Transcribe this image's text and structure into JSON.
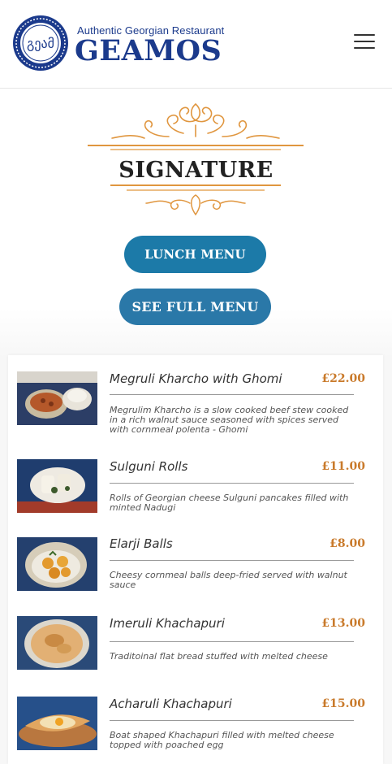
{
  "header": {
    "tagline": "Authentic Georgian Restaurant",
    "brand": "GEAMOS",
    "seal_text": "გეამ",
    "menu_icon": "hamburger-menu-icon"
  },
  "hero": {
    "heading": "SIGNATURE",
    "lunch_button": "LUNCH MENU",
    "full_menu_button": "SEE FULL MENU"
  },
  "colors": {
    "brand_blue": "#1b3a8c",
    "accent_orange": "#e0963f",
    "price": "#c97a2b",
    "button_blue": "#1c7aa8"
  },
  "menu": {
    "items": [
      {
        "name": "Megruli Kharcho with Ghomi",
        "price": "£22.00",
        "description": "Megrulim Kharcho is a slow cooked beef stew cooked in a rich walnut sauce seasoned with spices served with cornmeal polenta - Ghomi",
        "image": "kharcho-dish-photo"
      },
      {
        "name": "Sulguni Rolls",
        "price": "£11.00",
        "description": "Rolls of Georgian cheese Sulguni pancakes filled with minted Nadugi",
        "image": "sulguni-rolls-photo"
      },
      {
        "name": "Elarji Balls",
        "price": "£8.00",
        "description": "Cheesy cornmeal balls deep-fried served with walnut sauce",
        "image": "elarji-balls-photo"
      },
      {
        "name": "Imeruli Khachapuri",
        "price": "£13.00",
        "description": "Traditoinal flat bread stuffed with melted cheese",
        "image": "imeruli-khachapuri-photo"
      },
      {
        "name": "Acharuli Khachapuri",
        "price": "£15.00",
        "description": "Boat shaped Khachapuri filled with melted cheese topped with poached egg",
        "image": "acharuli-khachapuri-photo"
      }
    ]
  }
}
